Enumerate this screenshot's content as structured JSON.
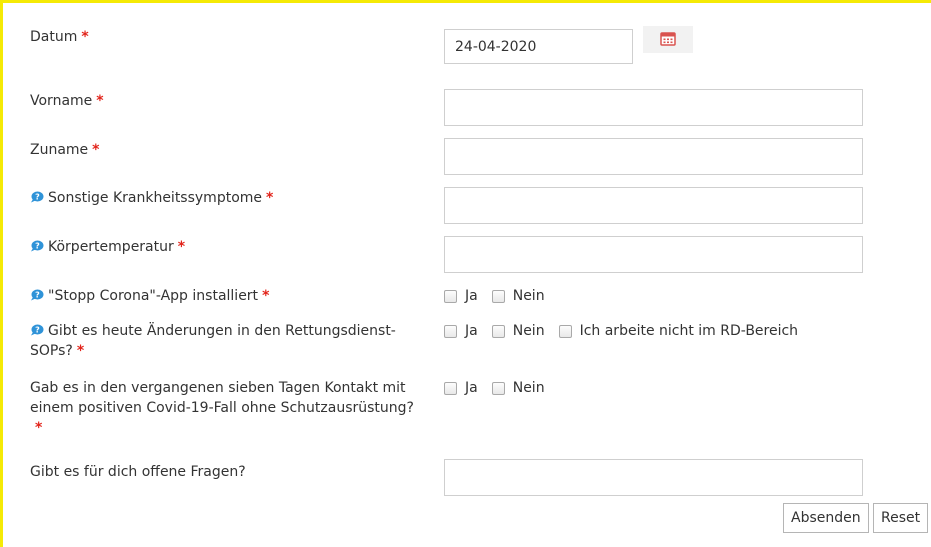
{
  "colors": {
    "frame": "#f5ea06",
    "required": "#e2231a",
    "help_icon": "#2f93d8",
    "calendar_icon": "#d9534f"
  },
  "required_marker": "*",
  "fields": {
    "datum": {
      "label": "Datum",
      "value": "24-04-2020"
    },
    "vorname": {
      "label": "Vorname",
      "value": ""
    },
    "zuname": {
      "label": "Zuname",
      "value": ""
    },
    "symptome": {
      "label": "Sonstige Krankheitssymptome",
      "value": ""
    },
    "temperatur": {
      "label": "Körpertemperatur",
      "value": ""
    },
    "stopp_corona": {
      "label": "\"Stopp Corona\"-App installiert",
      "options": [
        "Ja",
        "Nein"
      ]
    },
    "sops": {
      "label_line1": "Gibt es heute Änderungen in den Rettungsdienst-",
      "label_line2": "SOPs?",
      "options": [
        "Ja",
        "Nein",
        "Ich arbeite nicht im RD-Bereich"
      ]
    },
    "kontakt": {
      "label_line1": "Gab es in den vergangenen sieben Tagen Kontakt mit",
      "label_line2": "einem positiven Covid-19-Fall ohne Schutzausrüstung?",
      "options": [
        "Ja",
        "Nein"
      ]
    },
    "fragen": {
      "label": "Gibt es für dich offene Fragen?",
      "value": ""
    }
  },
  "icons": {
    "help": "help-bubble-icon",
    "calendar": "calendar-icon"
  },
  "buttons": {
    "submit": "Absenden",
    "reset": "Reset"
  }
}
